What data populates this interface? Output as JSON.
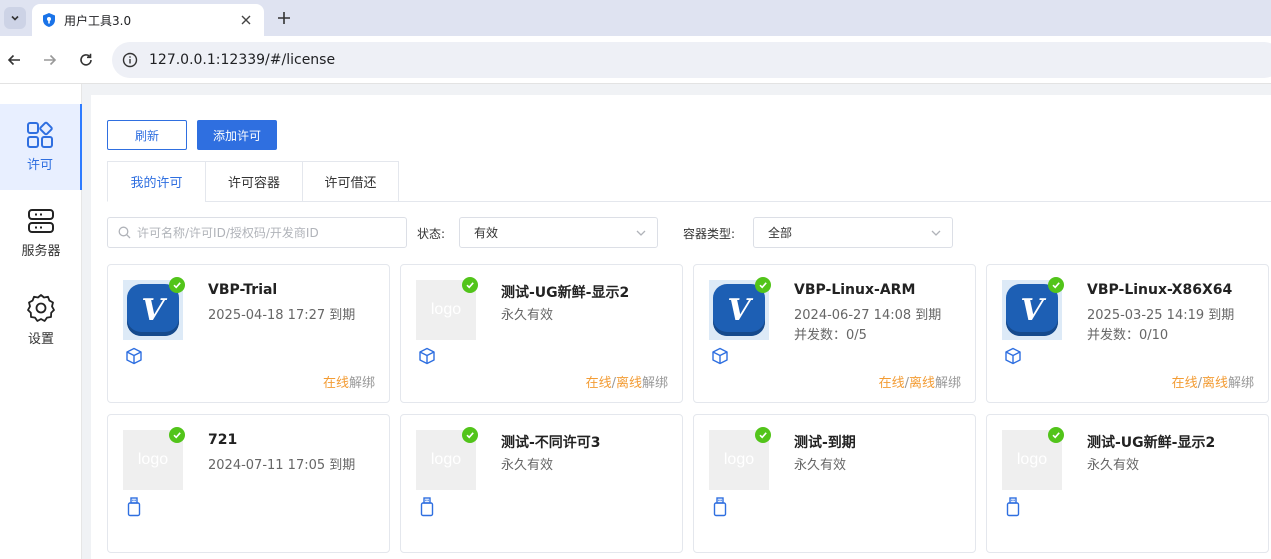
{
  "browser": {
    "tab_title": "用户工具3.0",
    "url": "127.0.0.1:12339/#/license"
  },
  "sidenav": [
    {
      "label": "许可",
      "icon": "apps-grid-icon",
      "active": true
    },
    {
      "label": "服务器",
      "icon": "server-icon",
      "active": false
    },
    {
      "label": "设置",
      "icon": "gear-icon",
      "active": false
    }
  ],
  "toolbar": {
    "refresh_label": "刷新",
    "add_label": "添加许可"
  },
  "tabs": [
    "我的许可",
    "许可容器",
    "许可借还"
  ],
  "filters": {
    "search_placeholder": "许可名称/许可ID/授权码/开发商ID",
    "status_label": "状态:",
    "status_value": "有效",
    "container_label": "容器类型:",
    "container_value": "全部"
  },
  "cards": [
    {
      "name": "VBP-Trial",
      "lines": [
        "2025-04-18 17:27 到期"
      ],
      "thumb": "vbp",
      "container_icon": "cube-icon",
      "actions": {
        "online": "在线",
        "unbind": "解绑"
      }
    },
    {
      "name": "测试-UG新鲜-显示2",
      "lines": [
        "永久有效"
      ],
      "thumb": "logo",
      "container_icon": "cube-icon",
      "actions": {
        "online": "在线",
        "sep": "/",
        "offline": "离线",
        "unbind": "解绑"
      }
    },
    {
      "name": "VBP-Linux-ARM",
      "lines": [
        "2024-06-27 14:08 到期",
        "并发数：0/5"
      ],
      "thumb": "vbp",
      "container_icon": "cube-icon",
      "actions": {
        "online": "在线",
        "sep": "/",
        "offline": "离线",
        "unbind": "解绑"
      }
    },
    {
      "name": "VBP-Linux-X86X64",
      "lines": [
        "2025-03-25 14:19 到期",
        "并发数：0/10"
      ],
      "thumb": "vbp",
      "container_icon": "cube-icon",
      "actions": {
        "online": "在线",
        "sep": "/",
        "offline": "离线",
        "unbind": "解绑"
      }
    },
    {
      "name": "721",
      "lines": [
        "2024-07-11 17:05 到期"
      ],
      "thumb": "logo",
      "container_icon": "usb-icon"
    },
    {
      "name": "测试-不同许可3",
      "lines": [
        "永久有效"
      ],
      "thumb": "logo",
      "container_icon": "usb-icon"
    },
    {
      "name": "测试-到期",
      "lines": [
        "永久有效"
      ],
      "thumb": "logo",
      "container_icon": "usb-icon"
    },
    {
      "name": "测试-UG新鲜-显示2",
      "lines": [
        "永久有效"
      ],
      "thumb": "logo",
      "container_icon": "usb-icon"
    }
  ],
  "logo_text": "logo",
  "vbp_letter": "V",
  "colors": {
    "accent": "#2f6fe0",
    "ok": "#52c41a",
    "action": "#f39c34"
  }
}
